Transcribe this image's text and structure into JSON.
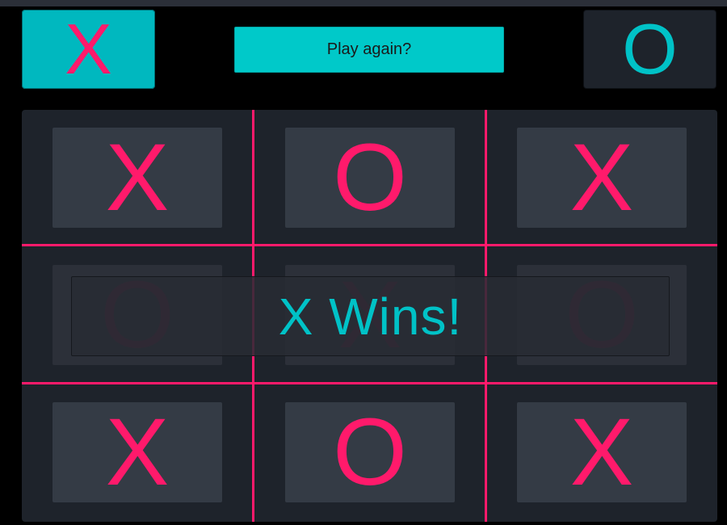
{
  "players": {
    "x": {
      "symbol": "X",
      "active": true
    },
    "o": {
      "symbol": "O",
      "active": false
    }
  },
  "play_again_label": "Play again?",
  "board": [
    [
      "X",
      "O",
      "X"
    ],
    [
      "O",
      "X",
      "O"
    ],
    [
      "X",
      "O",
      "X"
    ]
  ],
  "result_text": "X Wins!",
  "colors": {
    "mark": "#ff1a6b",
    "accent": "#00c2c7",
    "cell": "#343b45",
    "board": "#1e232b",
    "background": "#000000"
  }
}
